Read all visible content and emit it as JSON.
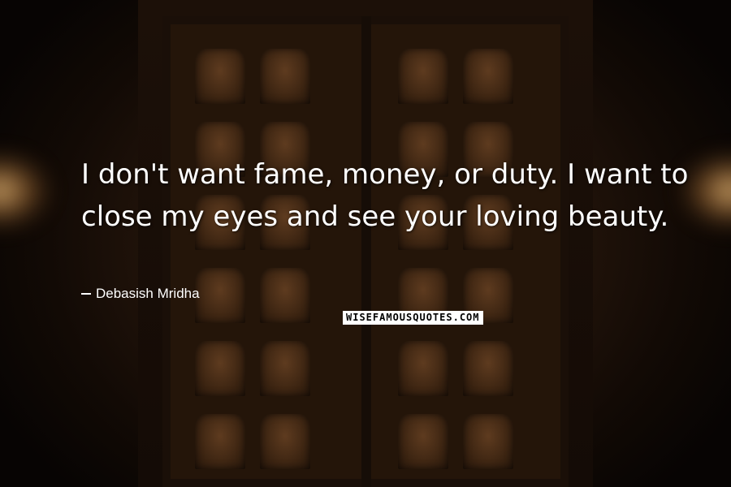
{
  "quote": {
    "text": "I don't want fame, money, or duty. I want to close my eyes and see your loving beauty."
  },
  "author": {
    "name": "Debasish Mridha"
  },
  "watermark": {
    "text": "WISEFAMOUSQUOTES.COM"
  }
}
